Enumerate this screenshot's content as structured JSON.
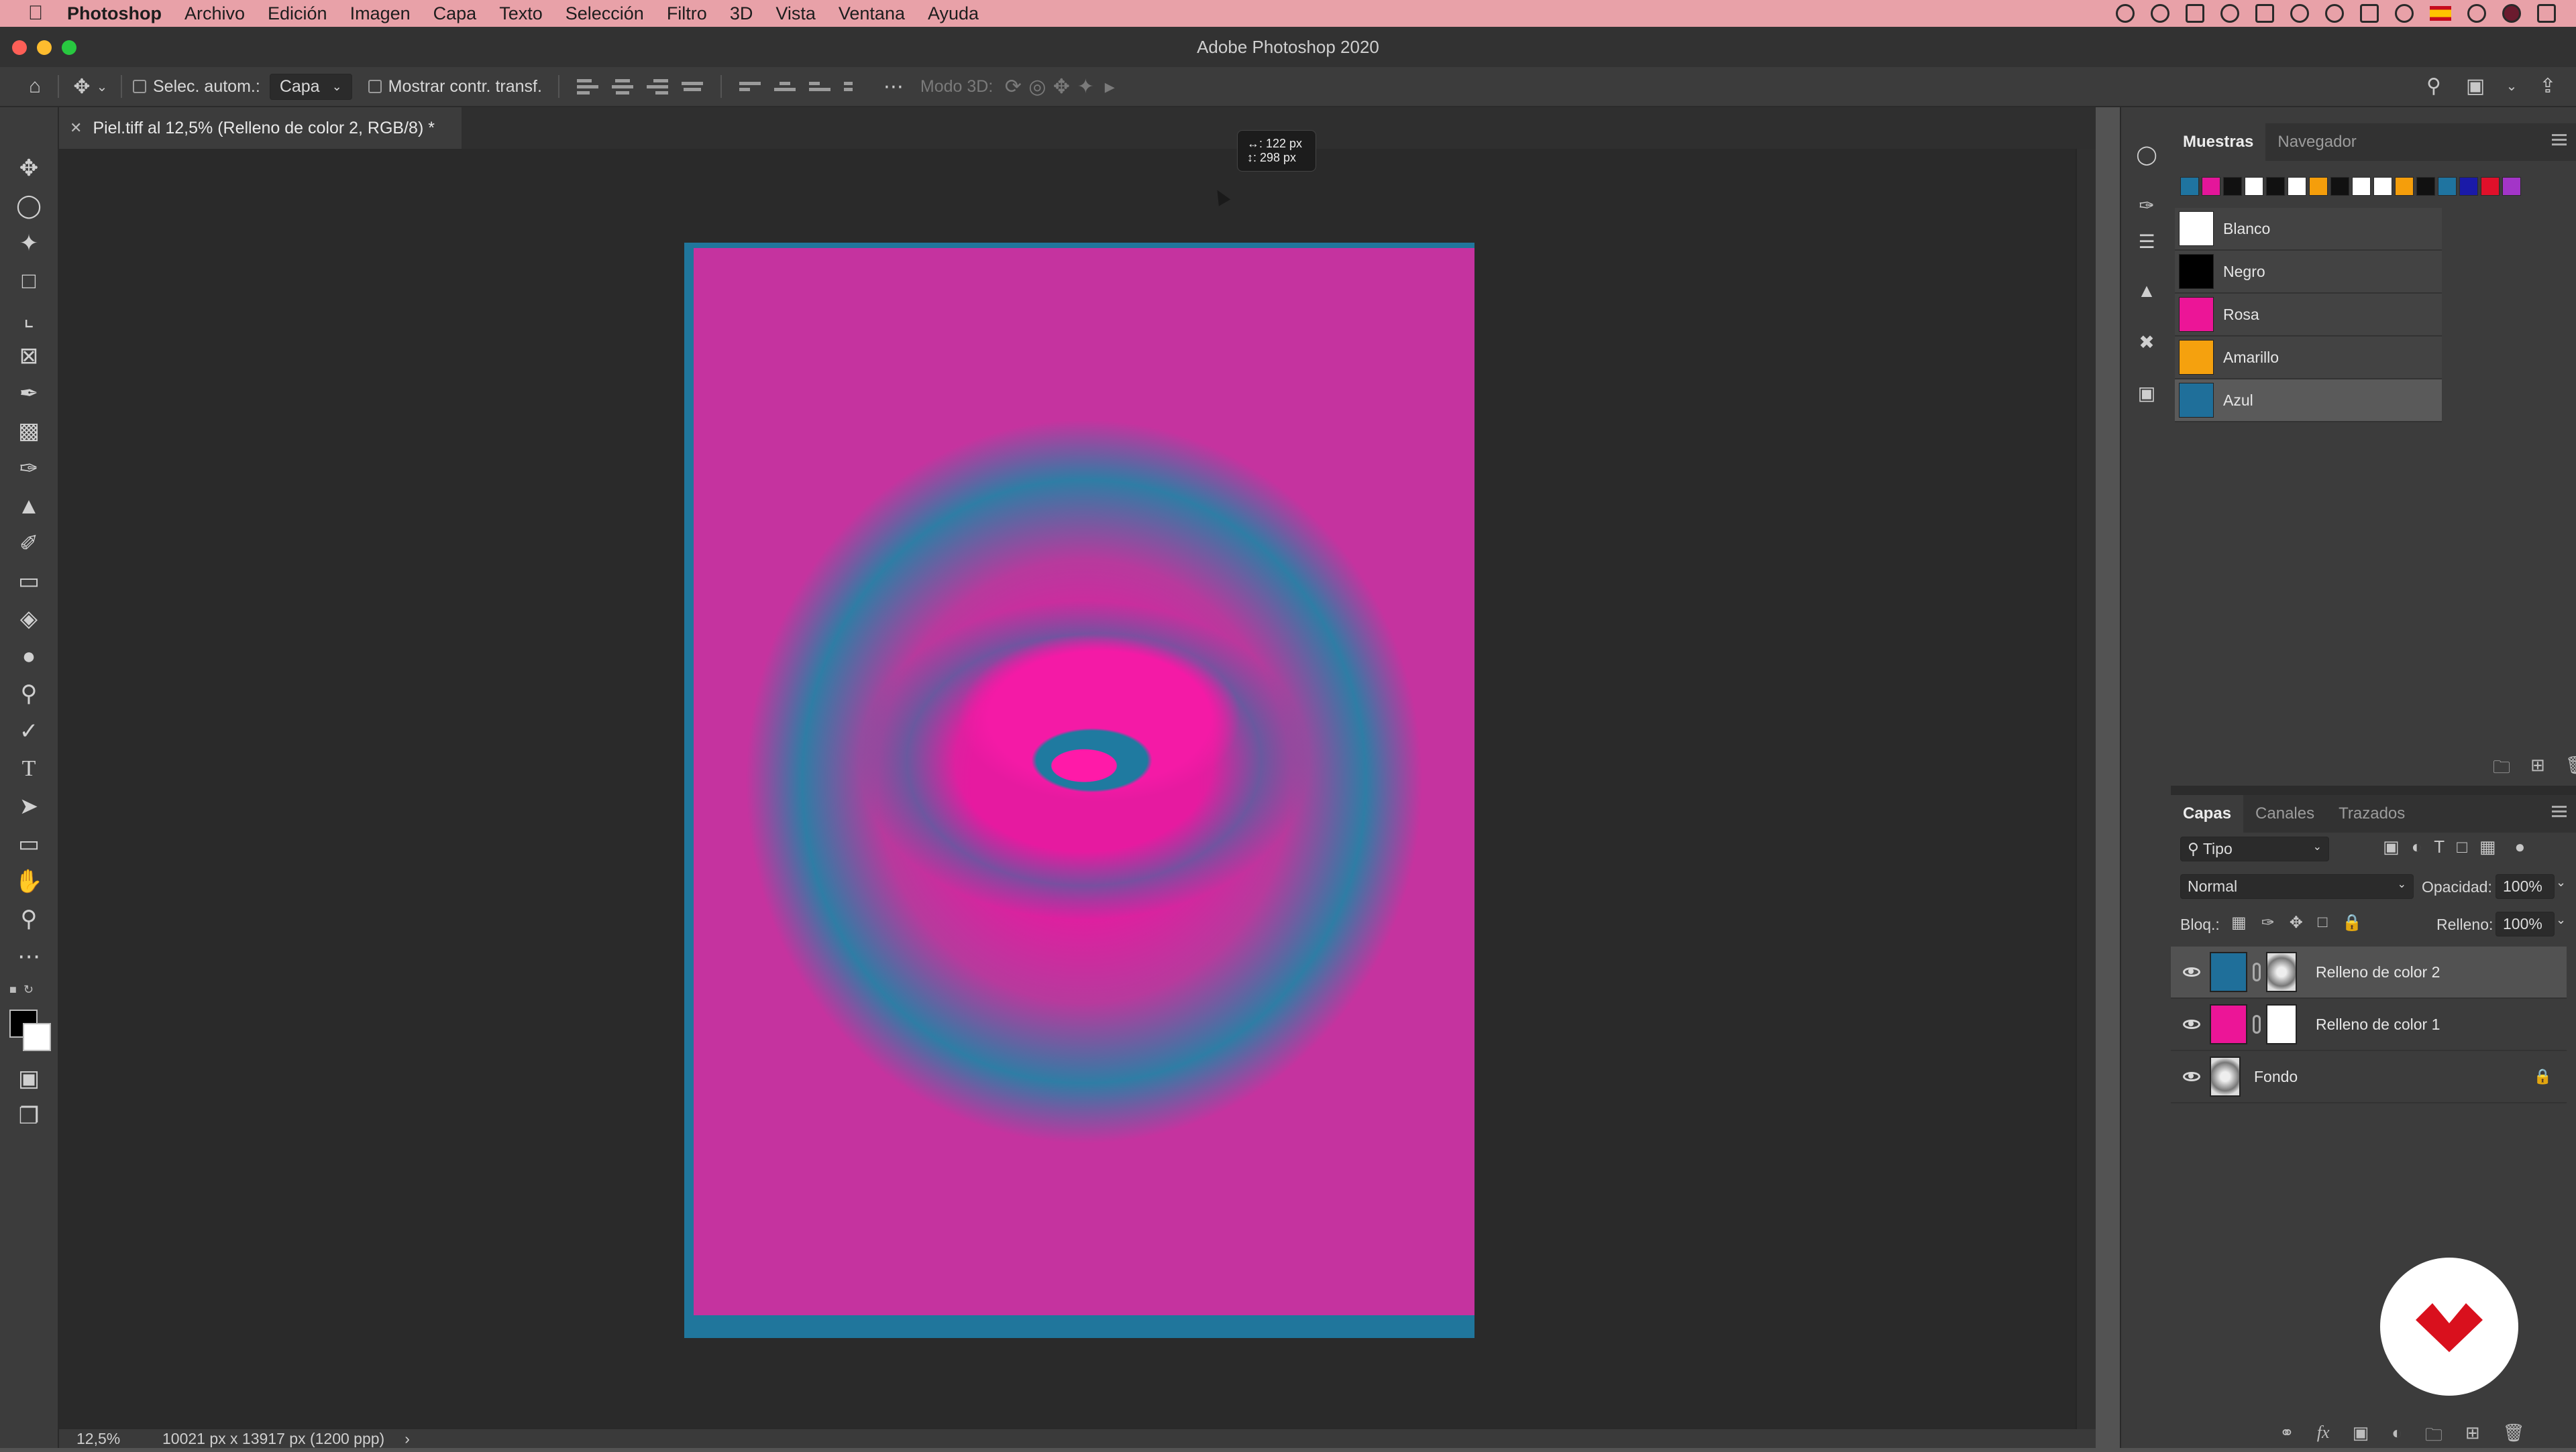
{
  "menubar": {
    "items": [
      "Photoshop",
      "Archivo",
      "Edición",
      "Imagen",
      "Capa",
      "Texto",
      "Selección",
      "Filtro",
      "3D",
      "Vista",
      "Ventana",
      "Ayuda"
    ]
  },
  "window": {
    "title": "Adobe Photoshop 2020"
  },
  "options": {
    "auto_select_label": "Selec. autom.:",
    "auto_select_value": "Capa",
    "show_transform_label": "Mostrar contr. transf.",
    "mode_3d_label": "Modo 3D:"
  },
  "document": {
    "tab_title": "Piel.tiff al 12,5% (Relleno de color 2, RGB/8) *",
    "tooltip_x": "↔: 122 px",
    "tooltip_y": "↕: 298 px"
  },
  "status": {
    "zoom": "12,5%",
    "dimensions": "10021 px x 13917 px (1200 ppp)",
    "more": "›"
  },
  "swatches_panel": {
    "tabs": [
      "Muestras",
      "Navegador"
    ],
    "row_colors": [
      "#1f74a0",
      "#e4169a",
      "#111111",
      "#ffffff",
      "#111111",
      "#ffffff",
      "#f59e0b",
      "#111111",
      "#ffffff",
      "#ffffff",
      "#f59e0b",
      "#111111",
      "#1f74a0",
      "#1a1aa8",
      "#e0102a",
      "#a335c8"
    ],
    "items": [
      {
        "name": "Blanco",
        "color": "#ffffff"
      },
      {
        "name": "Negro",
        "color": "#000000"
      },
      {
        "name": "Rosa",
        "color": "#ec1597"
      },
      {
        "name": "Amarillo",
        "color": "#f5a10e"
      },
      {
        "name": "Azul",
        "color": "#1f6f9a"
      }
    ]
  },
  "layers_panel": {
    "tabs": [
      "Capas",
      "Canales",
      "Trazados"
    ],
    "filter_value": "Tipo",
    "blend_mode": "Normal",
    "opacity_label": "Opacidad:",
    "opacity_value": "100%",
    "lock_label": "Bloq.:",
    "fill_label": "Relleno:",
    "fill_value": "100%",
    "layers": [
      {
        "name": "Relleno de color 2",
        "color": "#1f6f9a",
        "selected": true
      },
      {
        "name": "Relleno de color 1",
        "color": "#ec1597",
        "selected": false
      },
      {
        "name": "Fondo",
        "color": "#8a8a8a",
        "selected": false
      }
    ]
  }
}
